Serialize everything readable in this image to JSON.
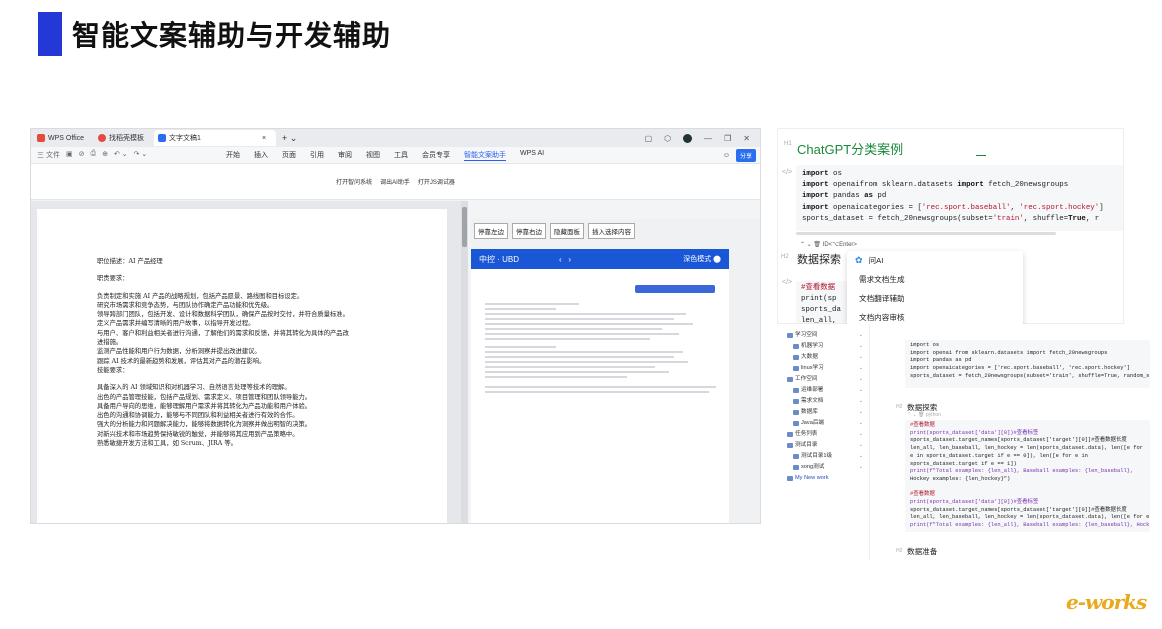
{
  "slide": {
    "title": "智能文案辅助与开发辅助"
  },
  "wps": {
    "tabs": [
      "WPS Office",
      "找稻壳模板",
      "文字文稿1"
    ],
    "menu_left": [
      "三 文件"
    ],
    "menu": [
      "开始",
      "插入",
      "页面",
      "引用",
      "审阅",
      "视图",
      "工具",
      "会员专享",
      "智能文案助手",
      "WPS AI"
    ],
    "share": "分享",
    "subtoolbar": [
      "打开智问系统",
      "调出AI助手",
      "打开JS调试器"
    ],
    "doc_lines": [
      "职位描述：AI 产品经理",
      "",
      "职责要求：",
      "",
      "负责制定和实施 AI 产品的战略规划，包括产品愿景、路线图和目标设定。",
      "研究市场需求和竞争态势，与团队协作确定产品功能和优先级。",
      "领导跨部门团队，包括开发、设计和数据科学团队，确保产品按时交付，并符合质量标准。",
      "定义产品需求并编写清晰的用户故事，以指导开发过程。",
      "与用户、客户和利益相关者进行沟通，了解他们的需求和反馈，并将其转化为具体的产品改",
      "进措施。",
      "监测产品性能和用户行为数据，分析洞察并提出改进建议。",
      "跟踪 AI 技术的最新趋势和发展，评估其对产品的潜在影响。",
      "技能要求：",
      "",
      "具备深入的 AI 领域知识和对机器学习、自然语言处理等技术的理解。",
      "出色的产品管理技能，包括产品规划、需求定义、项目管理和团队领导能力。",
      "具备用户导向的思维，能够理解用户需求并将其转化为产品功能和用户体验。",
      "出色的沟通和协调能力，能够与不同团队和利益相关者进行有效的合作。",
      "强大的分析能力和问题解决能力，能够将数据转化为洞察并做出明智的决策。",
      "对新兴技术和市场趋势保持敏锐的触觉，并能够将其应用到产品策略中。",
      "熟悉敏捷开发方法和工具，如 Scrum、JIRA 等。"
    ],
    "panel_buttons": [
      "停靠左边",
      "停靠右边",
      "隐藏面板",
      "插入选择内容"
    ],
    "ubd_title": "中控 · UBD",
    "ubd_mode": "深色模式"
  },
  "code1": {
    "title": "ChatGPT分类案例",
    "h2": "数据探索",
    "code_lines": [
      "import os",
      "import openaifrom sklearn.datasets import fetch_20newsgroups",
      "import pandas as pd",
      "import openaicategories = ['rec.sport.baseball', 'rec.sport.hockey']",
      "sports_dataset = fetch_20newsgroups(subset='train', shuffle=True, r"
    ],
    "code2_lines": [
      "#查看数据",
      "print(sp",
      "sports_da",
      "len_all,"
    ],
    "mini_tools": "⌃ ⌄ 🗑 ID<⌥Enter>",
    "popup_items": [
      "问AI",
      "需求文档生成",
      "文档翻译辅助",
      "文档内容审核"
    ]
  },
  "code2": {
    "tree": [
      {
        "label": "学习空间",
        "level": 0,
        "caret": "⌄"
      },
      {
        "label": "机器学习",
        "level": 1,
        "caret": "⌄"
      },
      {
        "label": "大数据",
        "level": 1,
        "caret": "⌄"
      },
      {
        "label": "linux学习",
        "level": 1,
        "caret": "⌄"
      },
      {
        "label": "工作空间",
        "level": 0,
        "caret": "⌄"
      },
      {
        "label": "运维部署",
        "level": 1,
        "caret": "⌄"
      },
      {
        "label": "需求文档",
        "level": 1,
        "caret": "⌄"
      },
      {
        "label": "数据库",
        "level": 1,
        "caret": "⌄"
      },
      {
        "label": "Java后端",
        "level": 1,
        "caret": "⌄"
      },
      {
        "label": "任务列表",
        "level": 0,
        "caret": "⌄"
      },
      {
        "label": "测试目录",
        "level": 0,
        "caret": "⌄"
      },
      {
        "label": "测试目录1级",
        "level": 1,
        "caret": "⌄"
      },
      {
        "label": "song测试",
        "level": 1,
        "caret": "⌄"
      },
      {
        "label": "My New work",
        "level": 0,
        "caret": ""
      }
    ],
    "block1": [
      "import os",
      "import openai from sklearn.datasets import fetch_20newsgroups",
      "import pandas as pd",
      "import openaicategories = ['rec.sport.baseball', 'rec.sport.hockey']",
      "sports_dataset = fetch_20newsgroups(subset='train', shuffle=True, random_s"
    ],
    "h2_a": "数据探索",
    "lang": "python",
    "block2": [
      "#查看数据",
      "print(sports_dataset['data'][0])#查看标签",
      "sports_dataset.target_names[sports_dataset['target'][0]]#查看数据长度",
      "len_all, len_baseball, len_hockey = len(sports_dataset.data), len([e for",
      "e in sports_dataset.target if e == 0]), len([e for e in",
      "sports_dataset.target if e == 1])",
      "print(f\"Total examples: {len_all}, Baseball examples: {len_baseball},",
      "Hockey examples: {len_hockey}\")",
      "",
      "#查看数据",
      "print(sports_dataset['data'][0])#查看标签",
      "sports_dataset.target_names[sports_dataset['target'][0]]#查看数据长度",
      "len_all, len_baseball, len_hockey = len(sports_dataset.data), len([e for e",
      "print(f\"Total examples: {len_all}, Baseball examples: {len_baseball}, Hock"
    ],
    "h2_b": "数据准备"
  },
  "logo": {
    "text": "e-works"
  },
  "colors": {
    "accent": "#2438d6",
    "green_title": "#1a8a3a",
    "wps_blue": "#2a6ff0",
    "logo": "#e8a91c"
  }
}
